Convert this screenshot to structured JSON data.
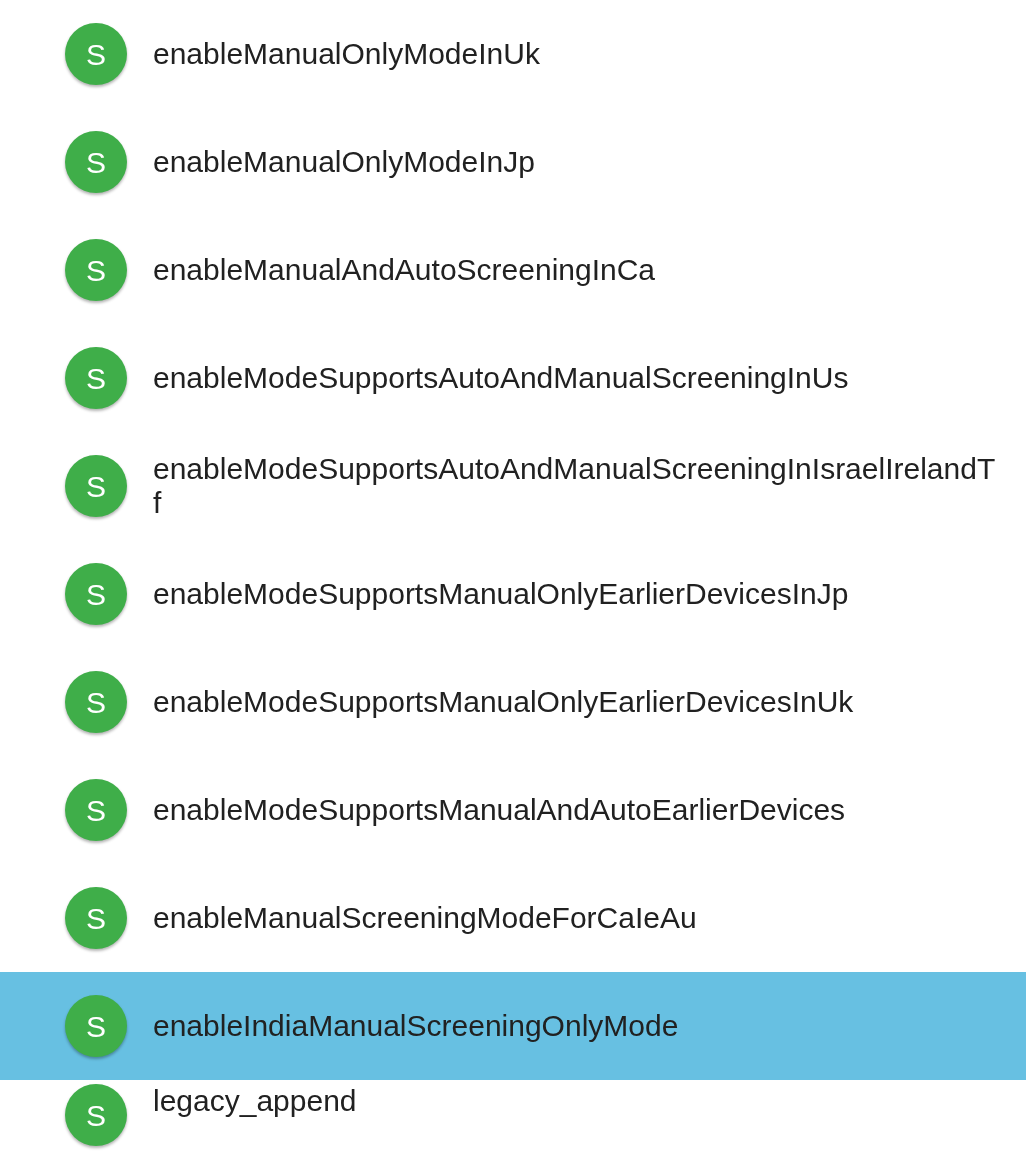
{
  "items": [
    {
      "avatar": "S",
      "label": "enableManualOnlyModeInUk",
      "selected": false
    },
    {
      "avatar": "S",
      "label": "enableManualOnlyModeInJp",
      "selected": false
    },
    {
      "avatar": "S",
      "label": "enableManualAndAutoScreeningInCa",
      "selected": false
    },
    {
      "avatar": "S",
      "label": "enableModeSupportsAutoAndManualScreeningInUs",
      "selected": false
    },
    {
      "avatar": "S",
      "label": "enableModeSupportsAutoAndManualScreeningInIsraelIrelandTf",
      "selected": false
    },
    {
      "avatar": "S",
      "label": "enableModeSupportsManualOnlyEarlierDevicesInJp",
      "selected": false
    },
    {
      "avatar": "S",
      "label": "enableModeSupportsManualOnlyEarlierDevicesInUk",
      "selected": false
    },
    {
      "avatar": "S",
      "label": "enableModeSupportsManualAndAutoEarlierDevices",
      "selected": false
    },
    {
      "avatar": "S",
      "label": "enableManualScreeningModeForCaIeAu",
      "selected": false
    },
    {
      "avatar": "S",
      "label": "enableIndiaManualScreeningOnlyMode",
      "selected": true
    },
    {
      "avatar": "S",
      "label": "legacy_append",
      "selected": false
    }
  ]
}
